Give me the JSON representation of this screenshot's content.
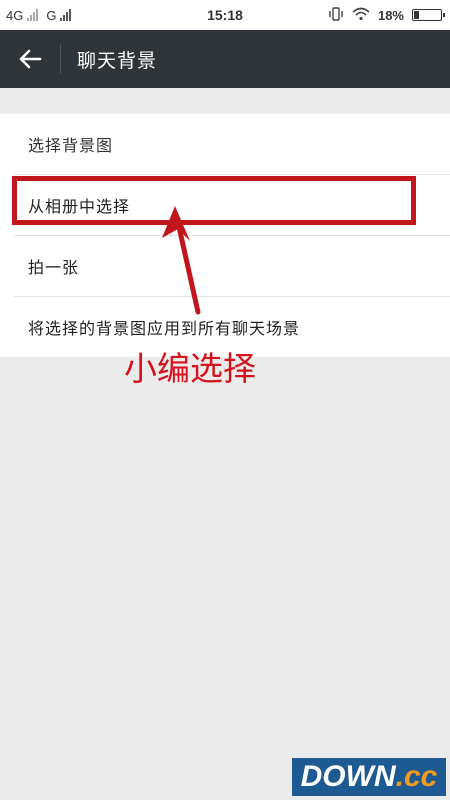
{
  "status_bar": {
    "net1": "4G",
    "net2": "G",
    "time": "15:18",
    "battery_text": "18%",
    "battery_level": 0.18
  },
  "app_bar": {
    "title": "聊天背景"
  },
  "list": {
    "section_header": "选择背景图",
    "items": [
      {
        "label": "从相册中选择"
      },
      {
        "label": "拍一张"
      },
      {
        "label": "将选择的背景图应用到所有聊天场景"
      }
    ]
  },
  "annotation": {
    "text": "小编选择",
    "color": "#d5121b"
  },
  "watermark": {
    "main": "DOWN",
    "dot": ".",
    "suffix": "cc"
  },
  "colors": {
    "app_bar": "#2f3439",
    "highlight": "#c0161c",
    "background": "#ebebeb"
  }
}
